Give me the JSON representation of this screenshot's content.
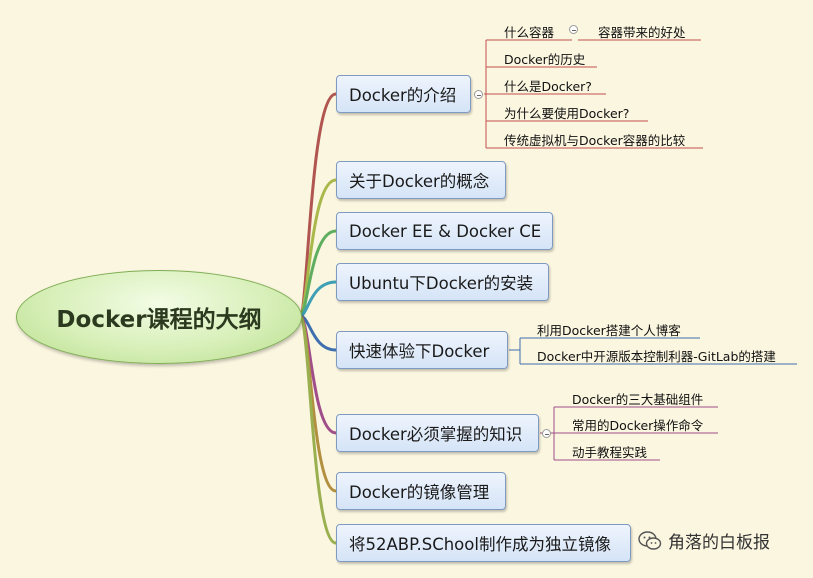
{
  "root": {
    "label": "Docker课程的大纲"
  },
  "topics": [
    {
      "label": "Docker的介绍",
      "subtopics": [
        "什么容器",
        "容器带来的好处",
        "Docker的历史",
        "什么是Docker?",
        "为什么要使用Docker?",
        "传统虚拟机与Docker容器的比较"
      ]
    },
    {
      "label": "关于Docker的概念",
      "subtopics": []
    },
    {
      "label": "Docker EE & Docker CE",
      "subtopics": []
    },
    {
      "label": "Ubuntu下Docker的安装",
      "subtopics": []
    },
    {
      "label": "快速体验下Docker",
      "subtopics": [
        "利用Docker搭建个人博客",
        "Docker中开源版本控制利器-GitLab的搭建"
      ]
    },
    {
      "label": "Docker必须掌握的知识",
      "subtopics": [
        "Docker的三大基础组件",
        "常用的Docker操作命令",
        "动手教程实践"
      ]
    },
    {
      "label": "Docker的镜像管理",
      "subtopics": []
    },
    {
      "label": "将52ABP.SChool制作成为独立镜像",
      "subtopics": []
    }
  ],
  "watermark": {
    "text": "角落的白板报",
    "icon": "wechat-icon"
  },
  "colors": {
    "background": "#fbf6e0",
    "branch_colors": [
      "#b0554f",
      "#a8b84a",
      "#5fae5f",
      "#3f9fb4",
      "#3f6fae",
      "#a04e8a",
      "#b29040",
      "#9ab050"
    ],
    "subtopic_underline": "#c0504d"
  }
}
